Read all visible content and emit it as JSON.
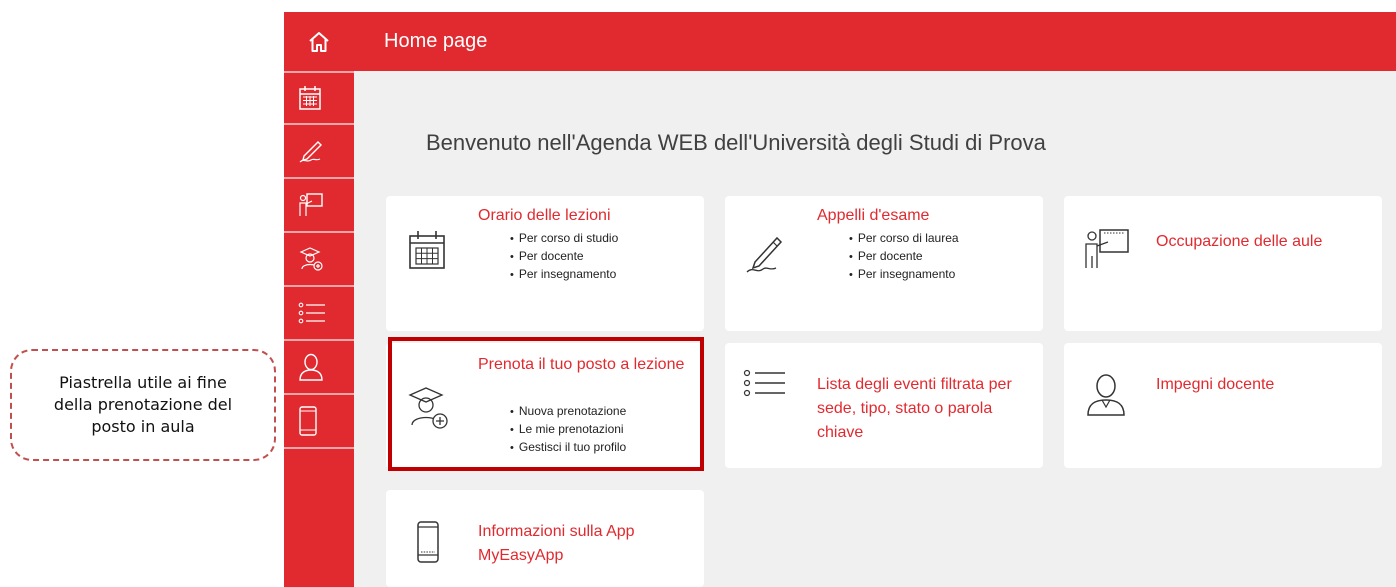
{
  "callout": {
    "text": "Piastrella utile ai fine della prenotazione del posto in aula"
  },
  "header": {
    "title": "Home page"
  },
  "sidebar": {
    "items": [
      {
        "icon": "calendar-icon"
      },
      {
        "icon": "signature-icon"
      },
      {
        "icon": "teacher-board-icon"
      },
      {
        "icon": "student-add-icon"
      },
      {
        "icon": "list-icon"
      },
      {
        "icon": "person-icon"
      },
      {
        "icon": "mobile-icon"
      }
    ]
  },
  "main": {
    "welcome": "Benvenuto nell'Agenda WEB dell'Università degli Studi di Prova",
    "tiles": [
      {
        "icon": "calendar-icon",
        "title": "Orario delle lezioni",
        "items": [
          "Per corso di studio",
          "Per docente",
          "Per insegnamento"
        ]
      },
      {
        "icon": "signature-icon",
        "title": "Appelli d'esame",
        "items": [
          "Per corso di laurea",
          "Per docente",
          "Per insegnamento"
        ]
      },
      {
        "icon": "teacher-board-icon",
        "title": "Occupazione delle aule",
        "items": []
      },
      {
        "icon": "student-add-icon",
        "title": "Prenota il tuo posto a lezione",
        "items": [
          "Nuova prenotazione",
          "Le mie prenotazioni",
          "Gestisci il tuo profilo"
        ]
      },
      {
        "icon": "list-icon",
        "title": "Lista degli eventi filtrata per sede, tipo, stato o parola chiave",
        "items": []
      },
      {
        "icon": "person-icon",
        "title": "Impegni docente",
        "items": []
      },
      {
        "icon": "mobile-icon",
        "title": "Informazioni sulla App MyEasyApp",
        "items": []
      }
    ]
  },
  "colors": {
    "brand": "#e12a2f",
    "highlight": "#c00000",
    "callout_border": "#c0504d",
    "background": "#f0f0f0"
  }
}
